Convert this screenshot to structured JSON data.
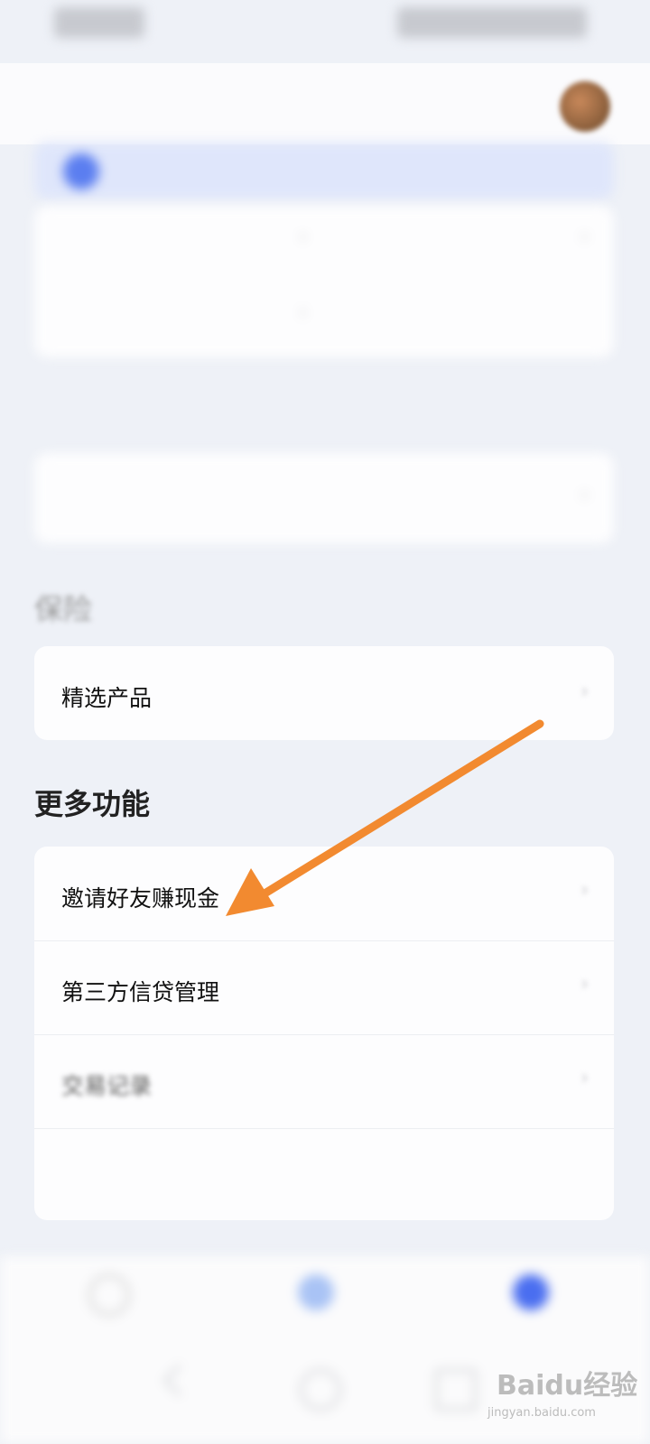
{
  "header": {
    "title": "",
    "banner_text": "",
    "banner_link": ""
  },
  "grid": {
    "cells": [
      "",
      "",
      "",
      ""
    ]
  },
  "sections": {
    "heading1": "",
    "heading2": "保险",
    "heading3": "更多功能"
  },
  "card1": {
    "label": "",
    "value": ""
  },
  "insurance": {
    "label": "精选产品",
    "value": ""
  },
  "more": {
    "items": [
      {
        "label": "邀请好友赚现金"
      },
      {
        "label": "第三方信贷管理"
      },
      {
        "label": "交易记录"
      },
      {
        "label": "",
        "value": ""
      }
    ]
  },
  "bottom_nav": {
    "items": [
      {
        "label": ""
      },
      {
        "label": ""
      },
      {
        "label": ""
      }
    ]
  },
  "watermark": {
    "logo": "Baidu经验",
    "url": "jingyan.baidu.com"
  },
  "colors": {
    "accent": "#5b7ef0",
    "arrow": "#f28a30",
    "background": "#eef1f7"
  },
  "icons": [
    "avatar",
    "banner-icon",
    "chevron-right-icon",
    "home-icon",
    "center-icon",
    "profile-icon"
  ]
}
